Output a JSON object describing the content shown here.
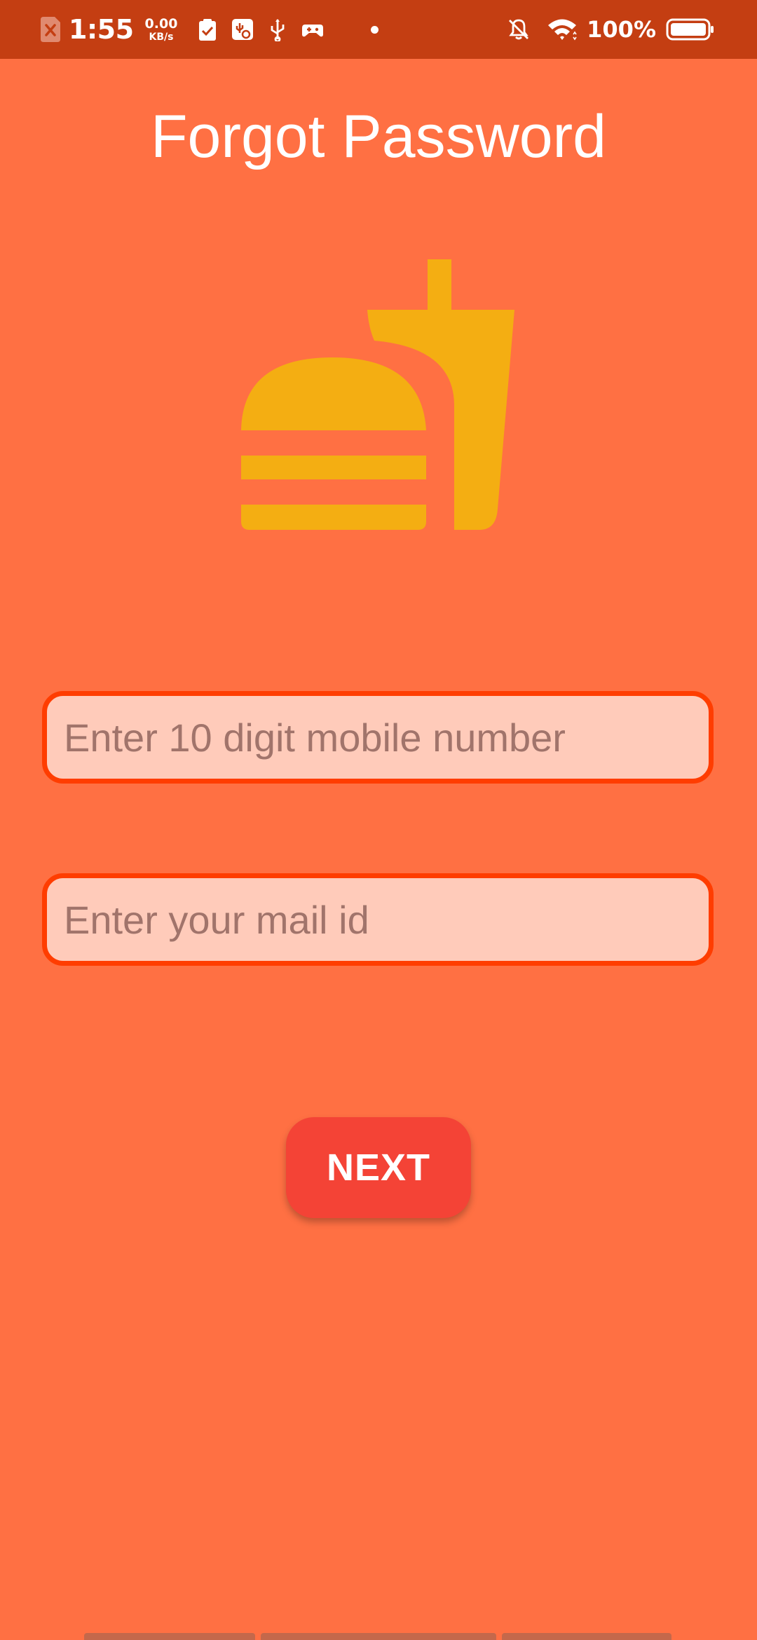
{
  "status_bar": {
    "time": "1:55",
    "net_speed_value": "0.00",
    "net_speed_unit": "KB/s",
    "battery_percent": "100%",
    "icons": [
      "sim-error-icon",
      "clipboard-check-icon",
      "usb-settings-icon",
      "usb-icon",
      "game-controller-icon",
      "notification-dot-icon",
      "bell-off-icon",
      "wifi-icon",
      "battery-icon"
    ]
  },
  "page": {
    "title": "Forgot Password"
  },
  "logo": {
    "icon": "fastfood-icon",
    "color": "#F4AE12"
  },
  "form": {
    "mobile_placeholder": "Enter 10 digit mobile number",
    "mobile_value": "",
    "mail_placeholder": "Enter your mail id",
    "mail_value": "",
    "next_label": "NEXT"
  },
  "colors": {
    "background": "#FF7043",
    "status_bar": "#C43E12",
    "field_border": "#FF3D00",
    "field_fill": "#FFCBBA",
    "button": "#F44336"
  }
}
